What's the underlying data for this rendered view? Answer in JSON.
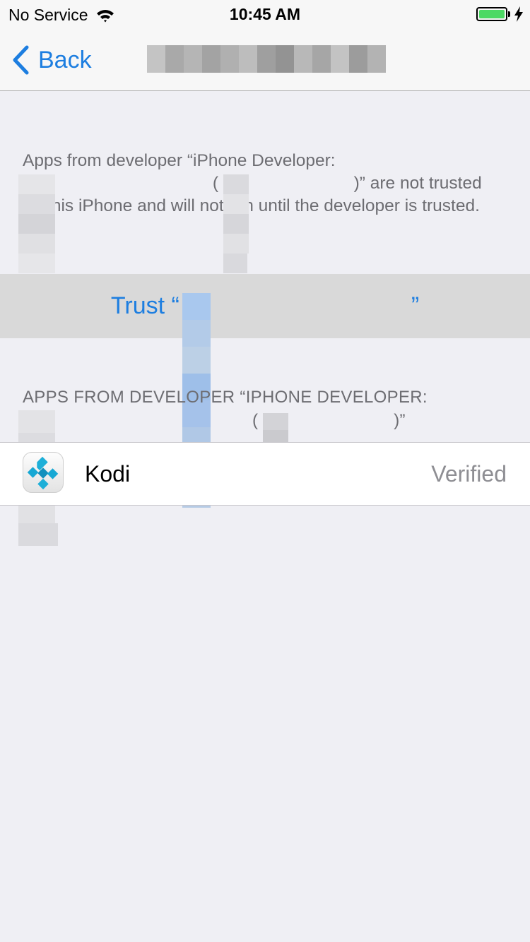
{
  "status_bar": {
    "carrier": "No Service",
    "time": "10:45 AM",
    "battery_color": "#4cd964"
  },
  "nav": {
    "back_label": "Back",
    "title_redacted": true
  },
  "description": {
    "line1": "Apps from developer “iPhone Developer:",
    "open_paren": "(",
    "mid": ")” are not trusted",
    "rest": "on this iPhone and will not run until the developer is trusted."
  },
  "trust": {
    "prefix": "Trust “",
    "suffix": "”",
    "accent": "#1d7ee0"
  },
  "section": {
    "header": "APPS FROM DEVELOPER “IPHONE DEVELOPER:",
    "open_paren": "(",
    "close": ")”"
  },
  "apps": [
    {
      "name": "Kodi",
      "status": "Verified",
      "icon": "kodi-icon"
    }
  ]
}
